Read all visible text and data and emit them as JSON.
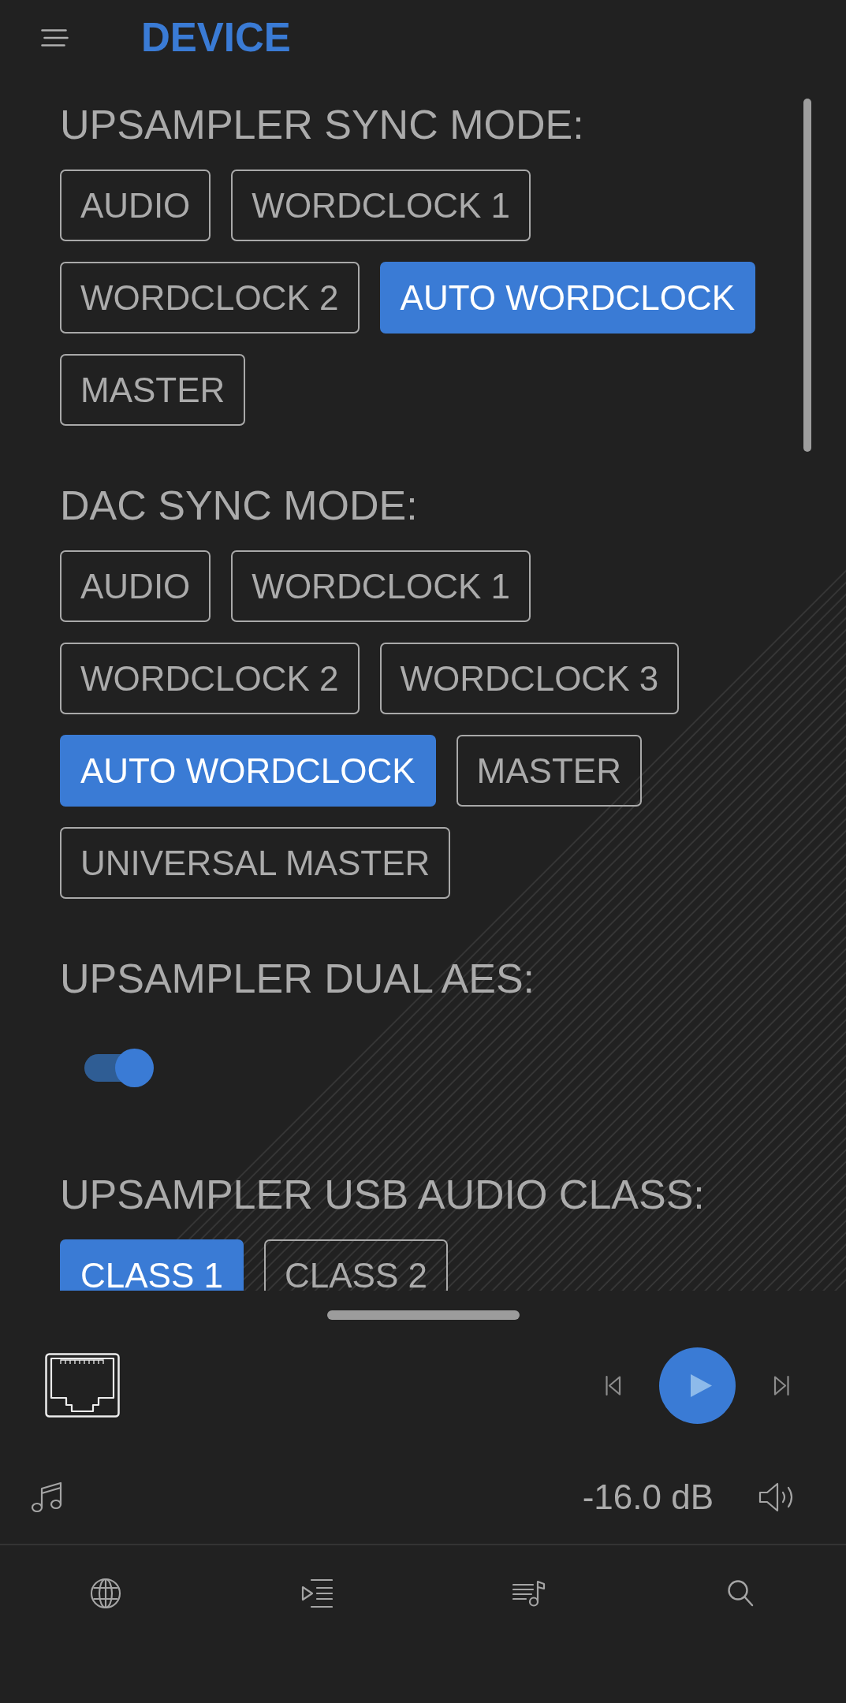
{
  "header": {
    "title": "DEVICE"
  },
  "sections": [
    {
      "kind": "options",
      "title": "UPSAMPLER SYNC MODE:",
      "options": [
        {
          "label": "AUDIO",
          "selected": false
        },
        {
          "label": "WORDCLOCK 1",
          "selected": false
        },
        {
          "label": "WORDCLOCK 2",
          "selected": false
        },
        {
          "label": "AUTO WORDCLOCK",
          "selected": true
        },
        {
          "label": "MASTER",
          "selected": false
        }
      ]
    },
    {
      "kind": "options",
      "title": "DAC SYNC MODE:",
      "options": [
        {
          "label": "AUDIO",
          "selected": false
        },
        {
          "label": "WORDCLOCK 1",
          "selected": false
        },
        {
          "label": "WORDCLOCK 2",
          "selected": false
        },
        {
          "label": "WORDCLOCK 3",
          "selected": false
        },
        {
          "label": "AUTO WORDCLOCK",
          "selected": true
        },
        {
          "label": "MASTER",
          "selected": false
        },
        {
          "label": "UNIVERSAL MASTER",
          "selected": false
        }
      ]
    },
    {
      "kind": "toggle",
      "title": "UPSAMPLER DUAL AES:",
      "on": true
    },
    {
      "kind": "options",
      "title": "UPSAMPLER USB AUDIO CLASS:",
      "options": [
        {
          "label": "CLASS 1",
          "selected": true
        },
        {
          "label": "CLASS 2",
          "selected": false
        }
      ]
    }
  ],
  "player": {
    "volume": "-16.0 dB"
  }
}
